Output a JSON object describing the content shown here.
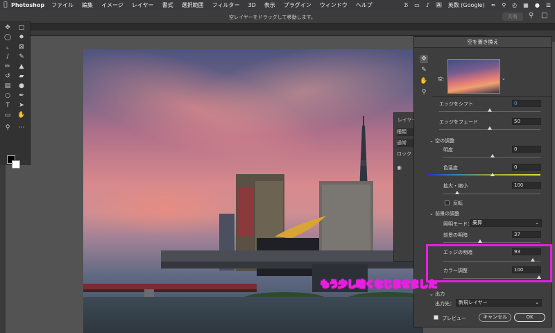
{
  "menubar": {
    "app": "Photoshop",
    "items": [
      "ファイル",
      "編集",
      "イメージ",
      "レイヤー",
      "書式",
      "選択範囲",
      "フィルター",
      "3D",
      "表示",
      "プラグイン",
      "ウィンドウ",
      "ヘルプ"
    ],
    "ime": "A",
    "input_source": "英数 (Google)"
  },
  "optbar": {
    "hint": "空レイヤーをドラッグして移動します。",
    "share": "共有"
  },
  "dialog": {
    "title": "空を置き換え",
    "sky_label": "空:",
    "shift_edge": {
      "label": "エッジをシフト",
      "value": "0"
    },
    "fade_edge": {
      "label": "エッジをフェード",
      "value": "50"
    },
    "sky_adjust": {
      "label": "空の調整",
      "brightness": {
        "label": "明度",
        "value": "0"
      },
      "temperature": {
        "label": "色温度",
        "value": "0"
      },
      "scale": {
        "label": "拡大・縮小",
        "value": "100"
      },
      "flip": "反転"
    },
    "foreground": {
      "label": "前景の調整",
      "mode_label": "照明モード：",
      "mode_value": "乗算",
      "lighting": {
        "label": "前景の明暗",
        "value": "37"
      },
      "edge_lighting": {
        "label": "エッジの明暗",
        "value": "93"
      },
      "color_adjust": {
        "label": "カラー調整",
        "value": "100"
      }
    },
    "output": {
      "label": "出力",
      "to_label": "出力先：",
      "to_value": "新規レイヤー"
    },
    "preview": "プレビュー",
    "cancel": "キャンセル",
    "ok": "OK"
  },
  "layers": {
    "title": "レイヤー",
    "rows": [
      "種類",
      "通常",
      "ロック"
    ]
  },
  "annotation": "もう少し暗くなじませました",
  "colors": {
    "highlight": "#e81fe0",
    "dialog_bg": "#3e3e3e"
  }
}
